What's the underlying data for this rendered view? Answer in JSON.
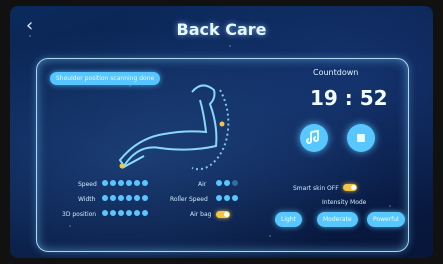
{
  "header": {
    "title": "Back Care",
    "back_icon": "chevron-left-icon"
  },
  "panel": {
    "shoulder_button": "Shoulder position scanning done",
    "countdown_label": "Countdown",
    "countdown_time": "19 : 52",
    "music_icon": "music-icon",
    "stop_icon": "stop-icon"
  },
  "settings": {
    "speed": {
      "label": "Speed",
      "level": 6,
      "max": 6
    },
    "width": {
      "label": "Width",
      "level": 6,
      "max": 6
    },
    "position": {
      "label": "3D position",
      "level": 6,
      "max": 6
    },
    "air": {
      "label": "Air",
      "level": 2,
      "max": 3
    },
    "roller_speed": {
      "label": "Roller Speed",
      "level": 3,
      "max": 3
    },
    "air_bag": {
      "label": "Air bag",
      "on": true
    },
    "smart_skin": {
      "label": "Smart skin OFF",
      "on": true
    },
    "intensity": {
      "label": "Intensity Mode",
      "options": [
        "Light",
        "Moderate",
        "Powerful"
      ],
      "selected": "Moderate"
    }
  },
  "colors": {
    "accent": "#59c7ff",
    "toggle_on": "#f4c542",
    "text": "#e8f6ff"
  }
}
